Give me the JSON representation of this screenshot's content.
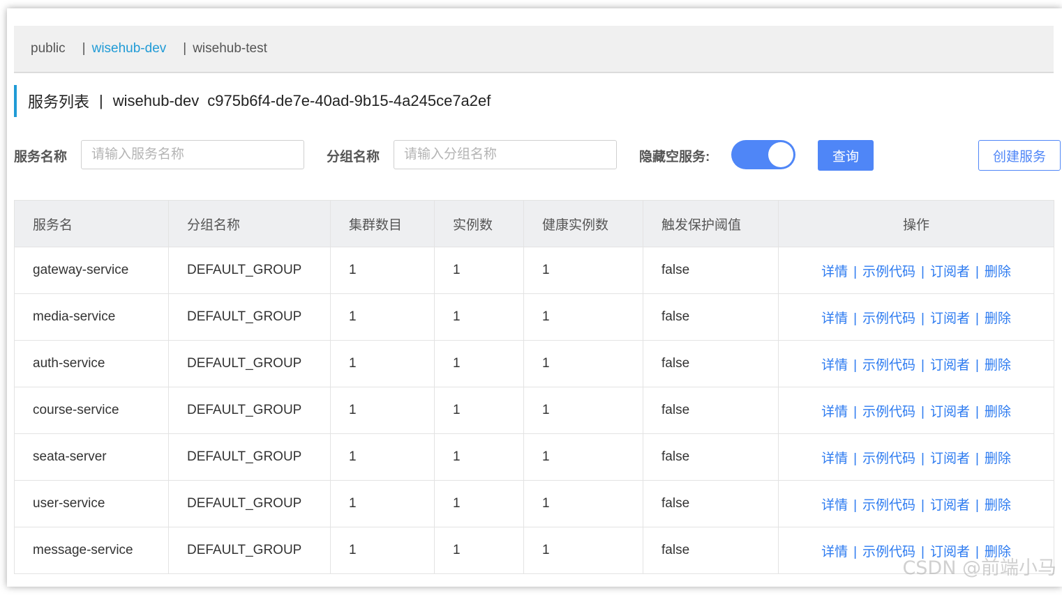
{
  "namespaces": [
    {
      "label": "public",
      "active": false
    },
    {
      "label": "wisehub-dev",
      "active": true
    },
    {
      "label": "wisehub-test",
      "active": false
    }
  ],
  "namespace_separator": "|",
  "title": {
    "main": "服务列表",
    "separator": "|",
    "namespace": "wisehub-dev",
    "namespace_id": "c975b6f4-de7e-40ad-9b15-4a245ce7a2ef"
  },
  "filters": {
    "service_name_label": "服务名称",
    "service_name_placeholder": "请输入服务名称",
    "group_name_label": "分组名称",
    "group_name_placeholder": "请输入分组名称",
    "hide_empty_label": "隐藏空服务:",
    "hide_empty_on": true,
    "query_button": "查询",
    "create_button": "创建服务"
  },
  "table": {
    "columns": [
      "服务名",
      "分组名称",
      "集群数目",
      "实例数",
      "健康实例数",
      "触发保护阈值",
      "操作"
    ],
    "rows": [
      [
        "gateway-service",
        "DEFAULT_GROUP",
        "1",
        "1",
        "1",
        "false"
      ],
      [
        "media-service",
        "DEFAULT_GROUP",
        "1",
        "1",
        "1",
        "false"
      ],
      [
        "auth-service",
        "DEFAULT_GROUP",
        "1",
        "1",
        "1",
        "false"
      ],
      [
        "course-service",
        "DEFAULT_GROUP",
        "1",
        "1",
        "1",
        "false"
      ],
      [
        "seata-server",
        "DEFAULT_GROUP",
        "1",
        "1",
        "1",
        "false"
      ],
      [
        "user-service",
        "DEFAULT_GROUP",
        "1",
        "1",
        "1",
        "false"
      ],
      [
        "message-service",
        "DEFAULT_GROUP",
        "1",
        "1",
        "1",
        "false"
      ]
    ],
    "actions": [
      "详情",
      "示例代码",
      "订阅者",
      "删除"
    ],
    "action_separator": "|"
  },
  "watermark": "CSDN @前端小马",
  "colors": {
    "accent": "#209bd6",
    "primary": "#4f86f7",
    "link": "#2d7bf0",
    "header_bg": "#eeeff1"
  }
}
